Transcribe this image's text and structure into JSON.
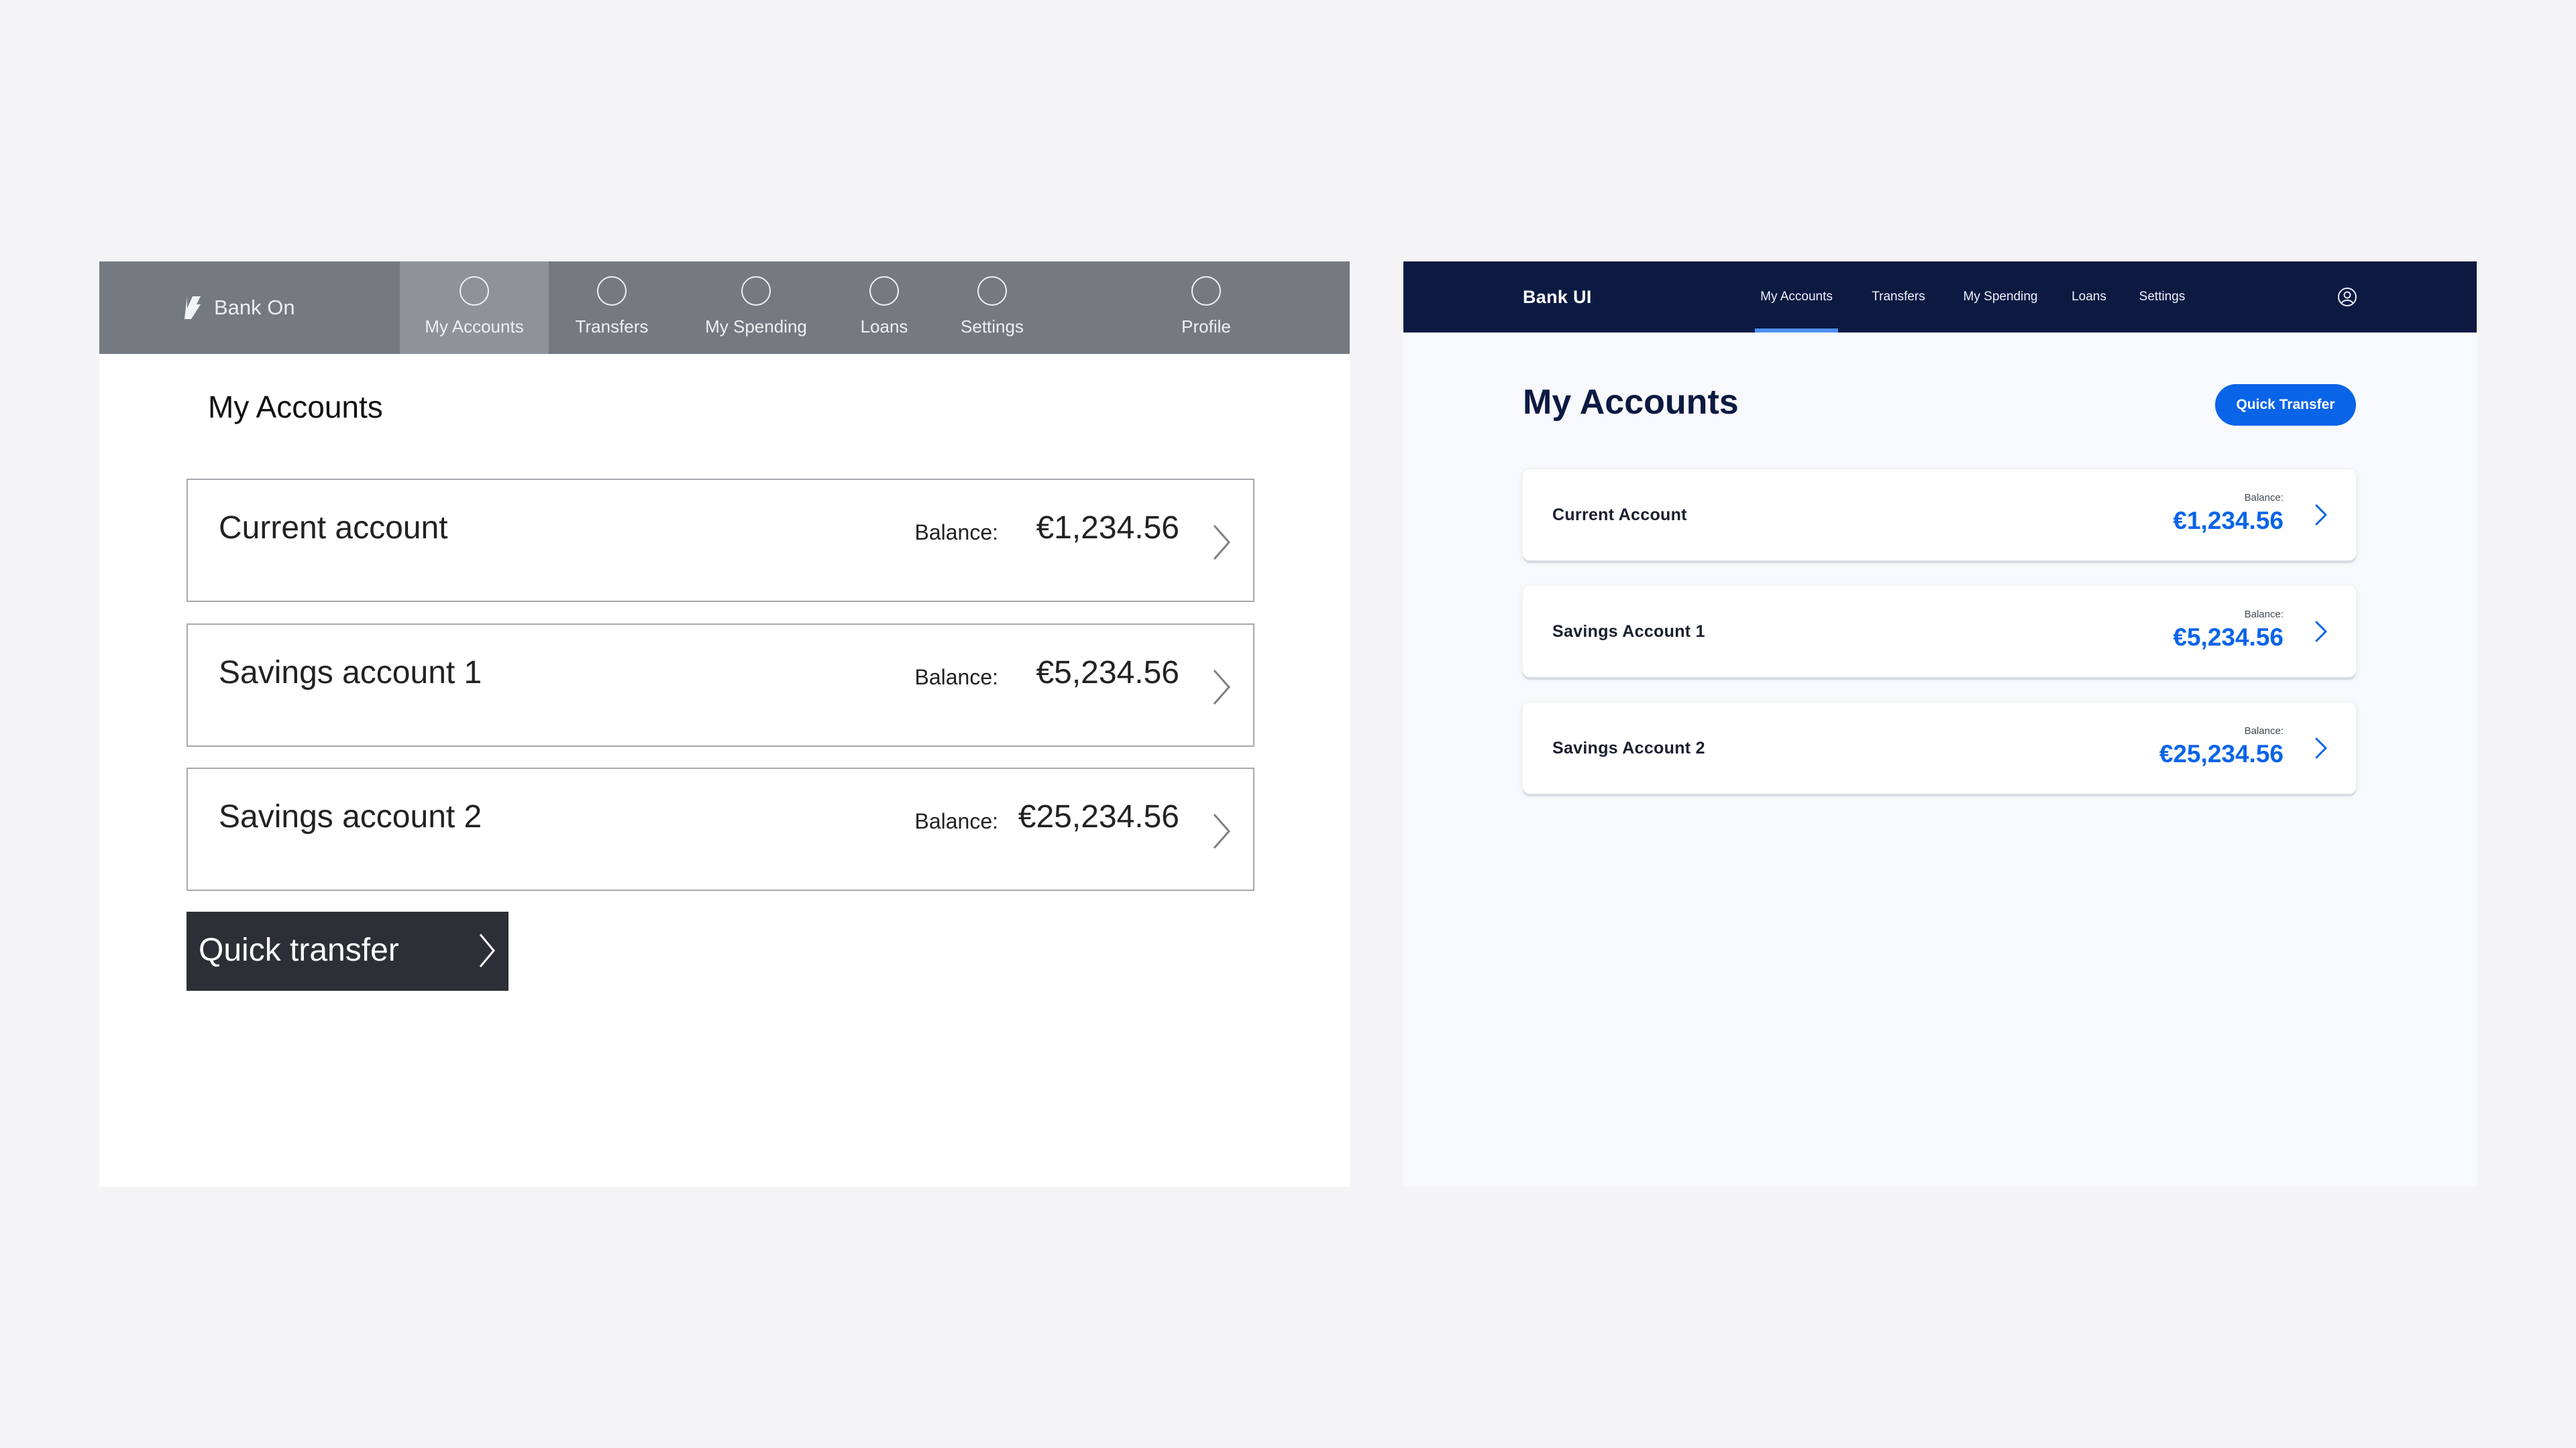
{
  "wireframe": {
    "brand": "Bank On",
    "nav": [
      {
        "label": "My Accounts",
        "active": true
      },
      {
        "label": "Transfers",
        "active": false
      },
      {
        "label": "My Spending",
        "active": false
      },
      {
        "label": "Loans",
        "active": false
      },
      {
        "label": "Settings",
        "active": false
      },
      {
        "label": "Profile",
        "active": false
      }
    ],
    "page_title": "My Accounts",
    "accounts": [
      {
        "name": "Current account",
        "balance_label": "Balance:",
        "balance": "€1,234.56"
      },
      {
        "name": "Savings account 1",
        "balance_label": "Balance:",
        "balance": "€5,234.56"
      },
      {
        "name": "Savings account 2",
        "balance_label": "Balance:",
        "balance": "€25,234.56"
      }
    ],
    "quick_transfer": "Quick transfer"
  },
  "final": {
    "brand": "Bank UI",
    "nav": [
      {
        "label": "My Accounts",
        "active": true
      },
      {
        "label": "Transfers",
        "active": false
      },
      {
        "label": "My Spending",
        "active": false
      },
      {
        "label": "Loans",
        "active": false
      },
      {
        "label": "Settings",
        "active": false
      }
    ],
    "page_title": "My Accounts",
    "quick_transfer": "Quick Transfer",
    "accounts": [
      {
        "name": "Current Account",
        "balance_label": "Balance:",
        "balance": "€1,234.56"
      },
      {
        "name": "Savings Account 1",
        "balance_label": "Balance:",
        "balance": "€5,234.56"
      },
      {
        "name": "Savings Account 2",
        "balance_label": "Balance:",
        "balance": "€25,234.56"
      }
    ],
    "colors": {
      "nav_bg": "#0c1a42",
      "accent": "#0a64e8",
      "active_indicator": "#4f8ff7"
    }
  }
}
